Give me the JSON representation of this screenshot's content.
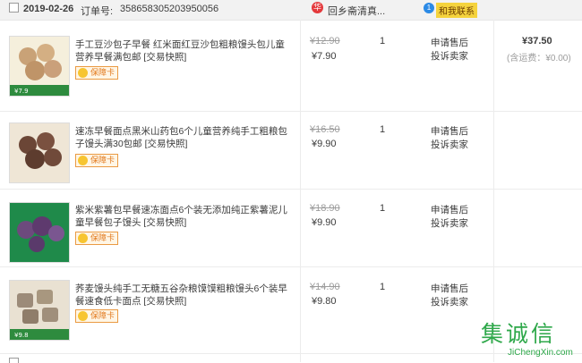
{
  "order": {
    "date": "2019-02-26",
    "order_label": "订单号:",
    "order_number": "358658305203950056",
    "shop_name": "回乡斋清真...",
    "ww_label": "和我联系",
    "total": "¥37.50",
    "shipping": "(含运费：¥0.00)"
  },
  "items": [
    {
      "title": "手工豆沙包子早餐 红米面红豆沙包粗粮馒头包儿童营养早餐满包邮 [交易快照]",
      "badge": "保障卡",
      "old_price": "¥12.90",
      "new_price": "¥7.90",
      "qty": "1",
      "op1": "申请售后",
      "op2": "投诉卖家",
      "thumb_price": "¥7.9"
    },
    {
      "title": "速冻早餐面点黑米山药包6个儿童营养纯手工粗粮包子馒头满30包邮 [交易快照]",
      "badge": "保障卡",
      "old_price": "¥16.50",
      "new_price": "¥9.90",
      "qty": "1",
      "op1": "申请售后",
      "op2": "投诉卖家",
      "thumb_price": ""
    },
    {
      "title": "紫米紫薯包早餐速冻面点6个装无添加纯正紫薯泥儿童早餐包子馒头 [交易快照]",
      "badge": "保障卡",
      "old_price": "¥18.90",
      "new_price": "¥9.90",
      "qty": "1",
      "op1": "申请售后",
      "op2": "投诉卖家",
      "thumb_price": ""
    },
    {
      "title": "荞麦馒头纯手工无糖五谷杂粮馍馍粗粮馒头6个装早餐速食低卡面点 [交易快照]",
      "badge": "保障卡",
      "old_price": "¥14.90",
      "new_price": "¥9.80",
      "qty": "1",
      "op1": "申请售后",
      "op2": "投诉卖家",
      "thumb_price": "¥9.8"
    }
  ],
  "watermark": {
    "main": "集诚信",
    "url": "JiChengXin.com"
  },
  "colors": {
    "accent": "#2ea84a",
    "badge": "#e27a1e",
    "shop_icon": "#e4393c"
  }
}
